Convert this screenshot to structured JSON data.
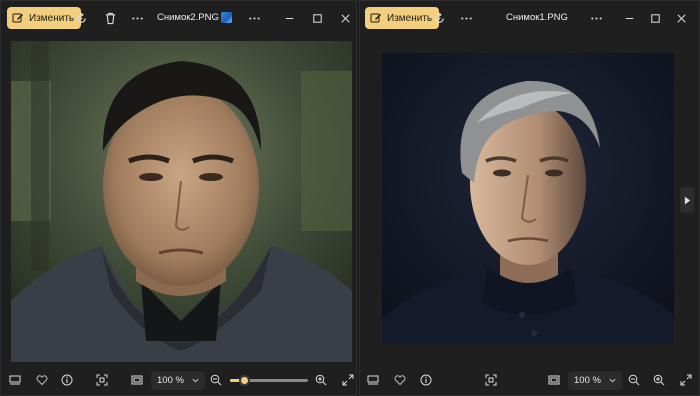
{
  "window_left": {
    "edit_label": "Изменить",
    "title": "Снимок2.PNG",
    "zoom": "100 %",
    "zoom_slider_value": 0.18,
    "icons": [
      "edit-icon",
      "rotate-icon",
      "delete-icon",
      "more-icon",
      "minimize-icon",
      "maximize-icon",
      "close-icon",
      "filmstrip-icon",
      "favorite-icon",
      "info-icon",
      "fit-icon",
      "fullscreen-view-icon",
      "zoom-out-icon",
      "zoom-in-icon",
      "expand-icon"
    ]
  },
  "window_right": {
    "edit_label": "Изменить",
    "title": "Снимок1.PNG",
    "zoom": "100 %",
    "icons": [
      "edit-icon",
      "rotate-icon",
      "more-icon",
      "minimize-icon",
      "maximize-icon",
      "close-icon",
      "filmstrip-icon",
      "favorite-icon",
      "info-icon",
      "fit-icon",
      "fullscreen-view-icon",
      "zoom-out-icon",
      "zoom-in-icon",
      "expand-icon",
      "next-arrow-icon"
    ]
  },
  "colors": {
    "accent": "#f3cf7d",
    "background": "#1f1f1f"
  }
}
